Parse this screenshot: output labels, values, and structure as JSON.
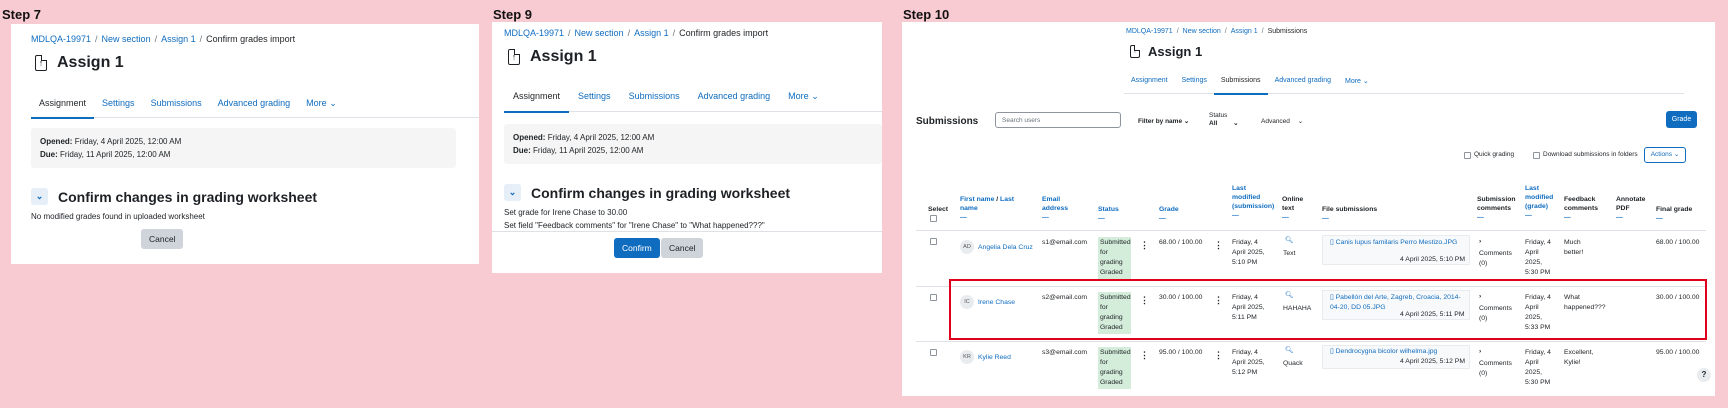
{
  "steps": {
    "s7": "Step 7",
    "s9": "Step 9",
    "s10": "Step 10"
  },
  "breadcrumb": {
    "course": "MDLQA-19971",
    "section": "New section",
    "assign": "Assign 1",
    "current_confirm": "Confirm grades import",
    "current_submissions": "Submissions"
  },
  "page_title": "Assign 1",
  "tabs": {
    "assignment": "Assignment",
    "settings": "Settings",
    "submissions": "Submissions",
    "advanced": "Advanced grading",
    "more": "More"
  },
  "step7": {
    "opened_label": "Opened:",
    "opened_value": "Friday, 4 April 2025, 12:00 AM",
    "due_label": "Due:",
    "due_value": "Friday, 11 April 2025, 12:00 AM",
    "heading": "Confirm changes in grading worksheet",
    "message": "No modified grades found in uploaded worksheet",
    "cancel": "Cancel"
  },
  "step9": {
    "opened_label": "Opened:",
    "opened_value": "Friday, 4 April 2025, 12:00 AM",
    "due_label": "Due:",
    "due_value": "Friday, 11 April 2025, 12:00 AM",
    "heading": "Confirm changes in grading worksheet",
    "line1": "Set grade for Irene Chase to 30.00",
    "line2": "Set field \"Feedback comments\" for \"Irene Chase\" to \"What happened???\"",
    "confirm": "Confirm",
    "cancel": "Cancel"
  },
  "step10": {
    "heading": "Submissions",
    "search_placeholder": "Search users",
    "filter_name": "Filter by name",
    "status_label": "Status",
    "status_value": "All",
    "advanced": "Advanced",
    "grade_btn": "Grade",
    "quick_grading": "Quick grading",
    "download_folders": "Download submissions in folders",
    "actions": "Actions",
    "headers": {
      "select": "Select",
      "first_name": "First name",
      "slash": " / ",
      "last_name": "Last name",
      "email": "Email address",
      "status": "Status",
      "grade": "Grade",
      "last_modified_sub": "Last modified (submission)",
      "online_text": "Online text",
      "file_submissions": "File submissions",
      "submission_comments": "Submission comments",
      "last_modified_grade": "Last modified (grade)",
      "feedback_comments": "Feedback comments",
      "annotate_pdf": "Annotate PDF",
      "final_grade": "Final grade",
      "dash": "—"
    },
    "rows": [
      {
        "initials": "AD",
        "name": "Angelia Dela Cruz",
        "email": "s1@email.com",
        "status1": "Submitted for grading",
        "status2": "Graded",
        "grade": "68.00 / 100.00",
        "modified": "Friday, 4 April 2025, 5:10 PM",
        "online": "Text",
        "file": "Canis lupus familaris Perro Mestizo.JPG",
        "file_date": "4 April 2025, 5:10 PM",
        "comments": "Comments (0)",
        "graded": "Friday, 4 April 2025, 5:30 PM",
        "feedback": "Much better!",
        "final": "68.00 / 100.00"
      },
      {
        "initials": "IC",
        "name": "Irene Chase",
        "email": "s2@email.com",
        "status1": "Submitted for grading",
        "status2": "Graded",
        "grade": "30.00 / 100.00",
        "modified": "Friday, 4 April 2025, 5:11 PM",
        "online": "HAHAHA",
        "file": "Pabellón del Arte, Zagreb, Croacia, 2014-04-20, DD 05.JPG",
        "file_date": "4 April 2025, 5:11 PM",
        "comments": "Comments (0)",
        "graded": "Friday, 4 April 2025, 5:33 PM",
        "feedback": "What happened???",
        "final": "30.00 / 100.00"
      },
      {
        "initials": "KR",
        "name": "Kylie Reed",
        "email": "s3@email.com",
        "status1": "Submitted for grading",
        "status2": "Graded",
        "grade": "95.00 / 100.00",
        "modified": "Friday, 4 April 2025, 5:12 PM",
        "online": "Quack",
        "file": "Dendrocygna bicolor wilhelma.jpg",
        "file_date": "4 April 2025, 5:12 PM",
        "comments": "Comments (0)",
        "graded": "Friday, 4 April 2025, 5:30 PM",
        "feedback": "Excellent, Kylie!",
        "final": "95.00 / 100.00"
      }
    ],
    "help": "?"
  }
}
